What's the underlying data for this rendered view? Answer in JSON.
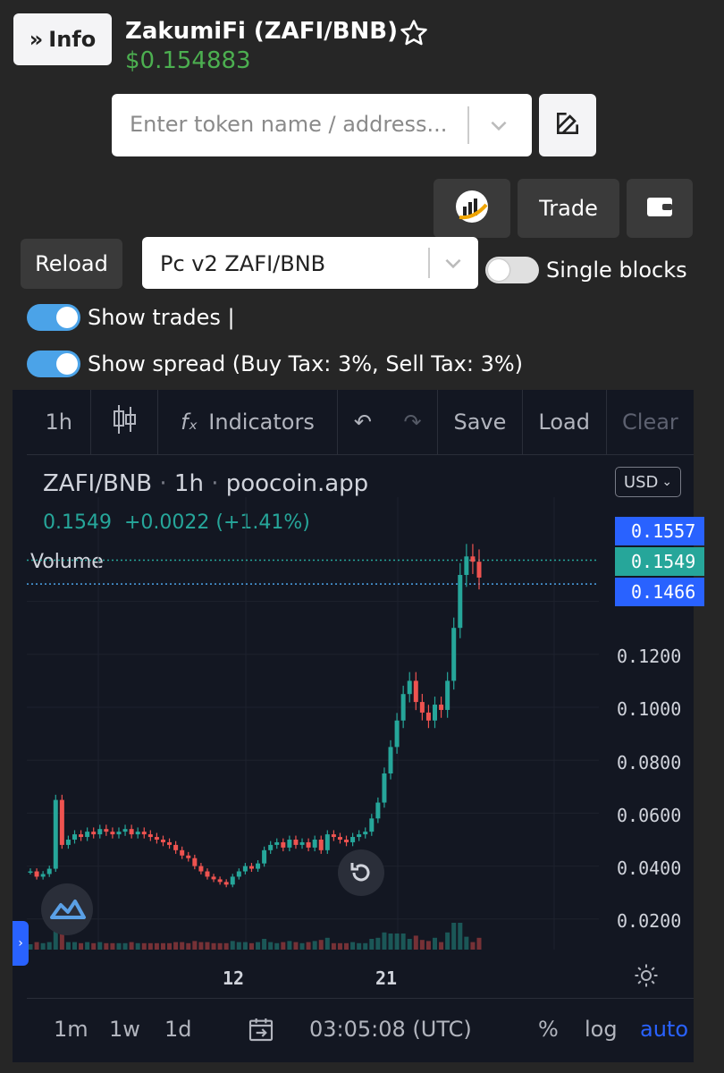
{
  "header": {
    "info_button": "Info",
    "title": "ZakumiFi (ZAFI/BNB)",
    "price": "$0.154883"
  },
  "search": {
    "placeholder": "Enter token name / address..."
  },
  "actions": {
    "trade_label": "Trade",
    "reload_label": "Reload"
  },
  "pair_select": {
    "value": "Pc v2 ZAFI/BNB"
  },
  "toggles": {
    "single_blocks": {
      "label": "Single blocks",
      "on": false
    },
    "show_trades": {
      "label": "Show trades |",
      "on": true
    },
    "show_spread": {
      "label": "Show spread (Buy Tax: 3%, Sell Tax: 3%)",
      "on": true
    }
  },
  "chart_toolbar": {
    "interval": "1h",
    "indicators": "Indicators",
    "save": "Save",
    "load": "Load",
    "clear": "Clear"
  },
  "chart_legend": {
    "symbol": "ZAFI/BNB",
    "interval": "1h",
    "source": "poocoin.app",
    "ohlc": "0.1549  +0.0022 (+1.41%)",
    "volume_label": "Volume"
  },
  "currency_select": "USD",
  "price_axis": [
    "0.1200",
    "0.1000",
    "0.0800",
    "0.0600",
    "0.0400",
    "0.0200"
  ],
  "price_tags": [
    "0.1557",
    "0.1549",
    "0.1466"
  ],
  "time_axis": [
    "12",
    "21"
  ],
  "chart_bottom": {
    "ranges": [
      "1m",
      "1w",
      "1d"
    ],
    "clock": "03:05:08 (UTC)",
    "percent": "%",
    "log": "log",
    "auto": "auto"
  },
  "colors": {
    "positive": "#26a69a",
    "negative": "#ef5350",
    "accent_blue": "#2962ff",
    "toggle_on": "#4ba3e8",
    "price_green": "#4caf50"
  },
  "chart_data": {
    "type": "candlestick",
    "title": "ZAFI/BNB · 1h · poocoin.app",
    "x_ticks": [
      "12",
      "21"
    ],
    "y_ticks": [
      0.02,
      0.04,
      0.06,
      0.08,
      0.1,
      0.12
    ],
    "ylim": [
      0.0,
      0.16
    ],
    "series": [
      {
        "values": [
          0.038,
          0.036,
          0.037,
          0.039,
          0.065,
          0.048,
          0.05,
          0.052,
          0.051,
          0.053,
          0.052,
          0.054,
          0.053,
          0.052,
          0.053,
          0.054,
          0.052,
          0.053,
          0.052,
          0.051,
          0.05,
          0.049,
          0.048,
          0.046,
          0.044,
          0.043,
          0.04,
          0.038,
          0.036,
          0.035,
          0.034,
          0.033,
          0.036,
          0.038,
          0.04,
          0.039,
          0.041,
          0.046,
          0.048,
          0.049,
          0.047,
          0.05,
          0.048,
          0.049,
          0.047,
          0.05,
          0.046,
          0.052,
          0.051,
          0.05,
          0.049,
          0.051,
          0.052,
          0.053,
          0.058,
          0.064,
          0.075,
          0.085,
          0.095,
          0.105,
          0.11,
          0.102,
          0.098,
          0.095,
          0.101,
          0.099,
          0.11,
          0.13,
          0.15,
          0.157,
          0.155,
          0.149
        ]
      }
    ]
  }
}
